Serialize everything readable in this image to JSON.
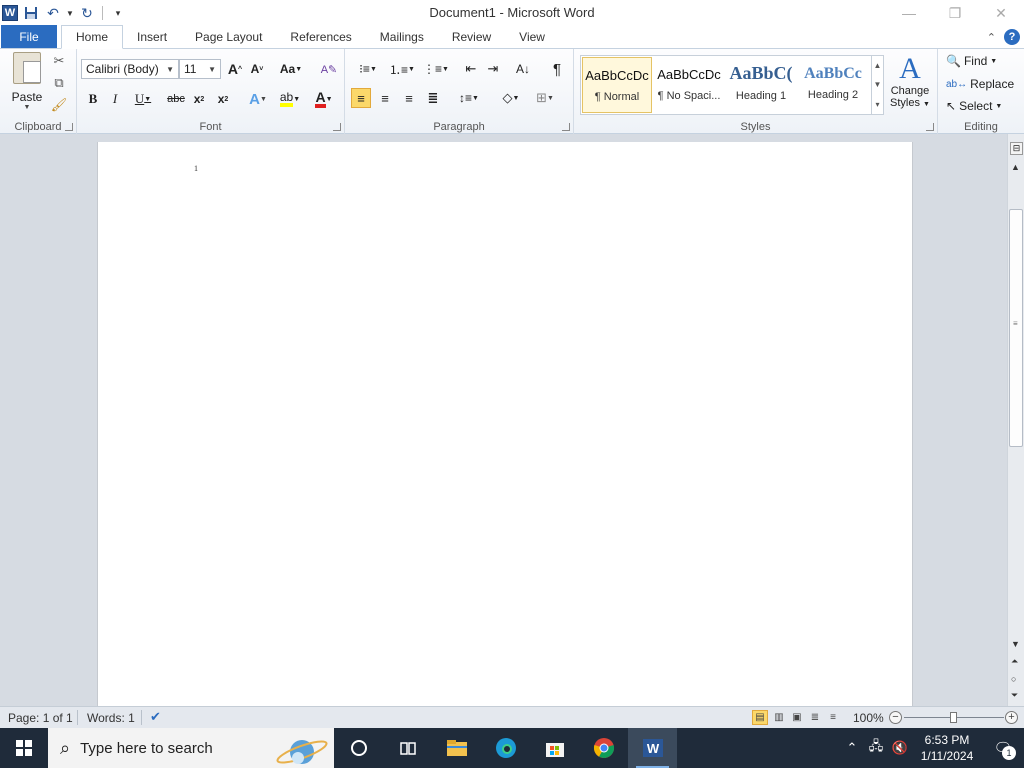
{
  "window": {
    "title": "Document1 - Microsoft Word"
  },
  "tabs": {
    "file": "File",
    "items": [
      "Home",
      "Insert",
      "Page Layout",
      "References",
      "Mailings",
      "Review",
      "View"
    ]
  },
  "clipboard": {
    "label": "Clipboard",
    "paste": "Paste"
  },
  "font": {
    "label": "Font",
    "font_name": "Calibri (Body)",
    "font_size": "11"
  },
  "paragraph": {
    "label": "Paragraph"
  },
  "styles": {
    "label": "Styles",
    "items": [
      {
        "sample": "AaBbCcDc",
        "name": "¶ Normal"
      },
      {
        "sample": "AaBbCcDc",
        "name": "¶ No Spaci..."
      },
      {
        "sample": "AaBbC(",
        "name": "Heading 1"
      },
      {
        "sample": "AaBbCc",
        "name": "Heading 2"
      }
    ],
    "change_styles_line1": "Change",
    "change_styles_line2": "Styles"
  },
  "editing": {
    "label": "Editing",
    "find": "Find",
    "replace": "Replace",
    "select": "Select"
  },
  "document": {
    "text": "1"
  },
  "statusbar": {
    "page": "Page: 1 of 1",
    "words": "Words: 1",
    "zoom": "100%"
  },
  "taskbar": {
    "search_placeholder": "Type here to search",
    "time": "6:53 PM",
    "date": "1/11/2024",
    "notification_count": "1"
  },
  "colors": {
    "accent": "#2b6cc0",
    "highlight": "#fbd86a",
    "taskbar": "#1f2b3a"
  }
}
